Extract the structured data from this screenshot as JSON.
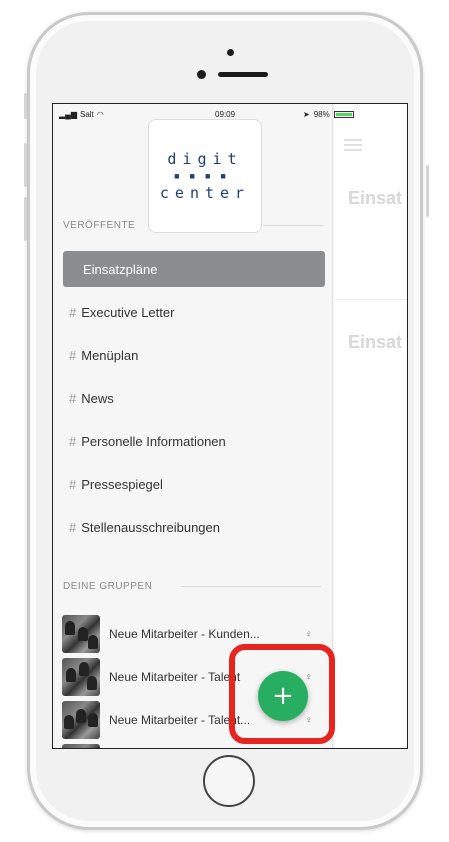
{
  "status_bar": {
    "carrier": "Salt",
    "time": "09:09",
    "battery": "98%"
  },
  "logo": {
    "line1": "digit",
    "line2": "center"
  },
  "sections": {
    "published": "VERÖFFENTE",
    "groups": "DEINE GRUPPEN"
  },
  "nav_items": [
    {
      "label": "Einsatzpläne",
      "active": true
    },
    {
      "label": "Executive Letter",
      "hash": "#"
    },
    {
      "label": "Menüplan",
      "hash": "#"
    },
    {
      "label": "News",
      "hash": "#"
    },
    {
      "label": "Personelle Informationen",
      "hash": "#"
    },
    {
      "label": "Pressespiegel",
      "hash": "#"
    },
    {
      "label": "Stellenausschreibungen",
      "hash": "#"
    }
  ],
  "groups": [
    {
      "label": "Neue Mitarbeiter - Kunden..."
    },
    {
      "label": "Neue Mitarbeiter - Talent"
    },
    {
      "label": "Neue Mitarbeiter - Talent..."
    }
  ],
  "background": {
    "title1": "Einsat",
    "title2": "Einsat"
  },
  "fab": {
    "icon": "plus-icon",
    "glyph": "+"
  },
  "colors": {
    "active_item": "#8b8d91",
    "fab": "#27ae60",
    "highlight": "#e8241f",
    "logo": "#1e3f7a"
  }
}
